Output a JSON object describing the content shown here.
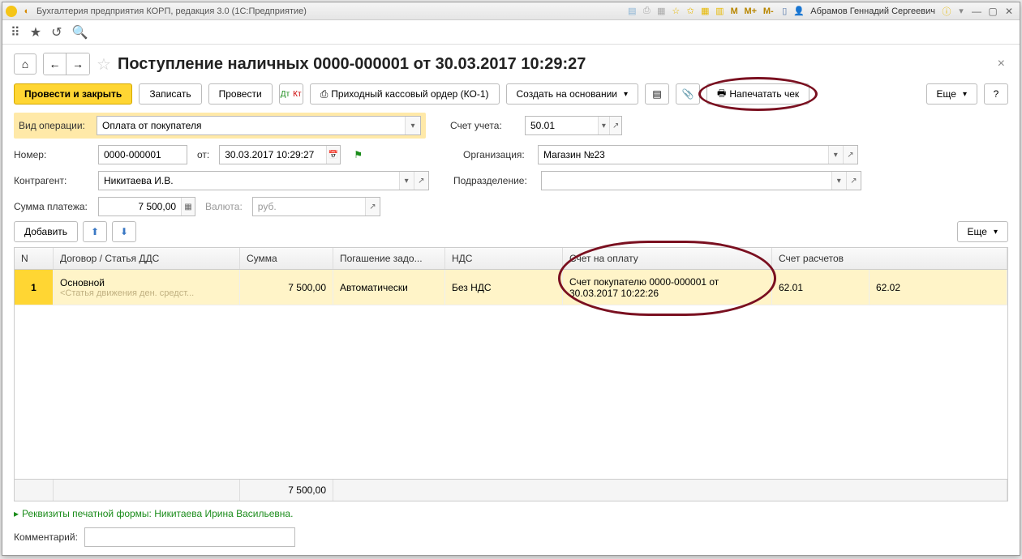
{
  "titlebar": {
    "app_title": "Бухгалтерия предприятия КОРП, редакция 3.0  (1С:Предприятие)",
    "user": "Абрамов Геннадий Сергеевич",
    "m_labels": [
      "M",
      "M+",
      "M-"
    ]
  },
  "header": {
    "title": "Поступление наличных 0000-000001 от 30.03.2017 10:29:27"
  },
  "actions": {
    "post_close": "Провести и закрыть",
    "write": "Записать",
    "post": "Провести",
    "print_order": "Приходный кассовый ордер (КО-1)",
    "create_based": "Создать на основании",
    "print_check": "Напечатать чек",
    "more": "Еще"
  },
  "form": {
    "op_type_label": "Вид операции:",
    "op_type_value": "Оплата от покупателя",
    "account_label": "Счет учета:",
    "account_value": "50.01",
    "number_label": "Номер:",
    "number_value": "0000-000001",
    "from_label": "от:",
    "date_value": "30.03.2017 10:29:27",
    "org_label": "Организация:",
    "org_value": "Магазин №23",
    "contractor_label": "Контрагент:",
    "contractor_value": "Никитаева И.В.",
    "division_label": "Подразделение:",
    "division_value": "",
    "sum_label": "Сумма платежа:",
    "sum_value": "7 500,00",
    "currency_label": "Валюта:",
    "currency_value": "руб."
  },
  "table_toolbar": {
    "add": "Добавить",
    "more": "Еще"
  },
  "table": {
    "headers": {
      "n": "N",
      "contract": "Договор / Статья ДДС",
      "sum": "Сумма",
      "payoff": "Погашение задо...",
      "vat": "НДС",
      "invoice": "Счет на оплату",
      "accounts": "Счет расчетов"
    },
    "row": {
      "n": "1",
      "contract": "Основной",
      "contract_sub": "<Статья движения ден. средст...",
      "sum": "7 500,00",
      "payoff": "Автоматически",
      "vat": "Без НДС",
      "invoice": "Счет покупателю 0000-000001 от 30.03.2017 10:22:26",
      "acc1": "62.01",
      "acc2": "62.02"
    },
    "footer_sum": "7 500,00"
  },
  "footer": {
    "print_details": "Реквизиты печатной формы: Никитаева Ирина Васильевна.",
    "comment_label": "Комментарий:"
  }
}
